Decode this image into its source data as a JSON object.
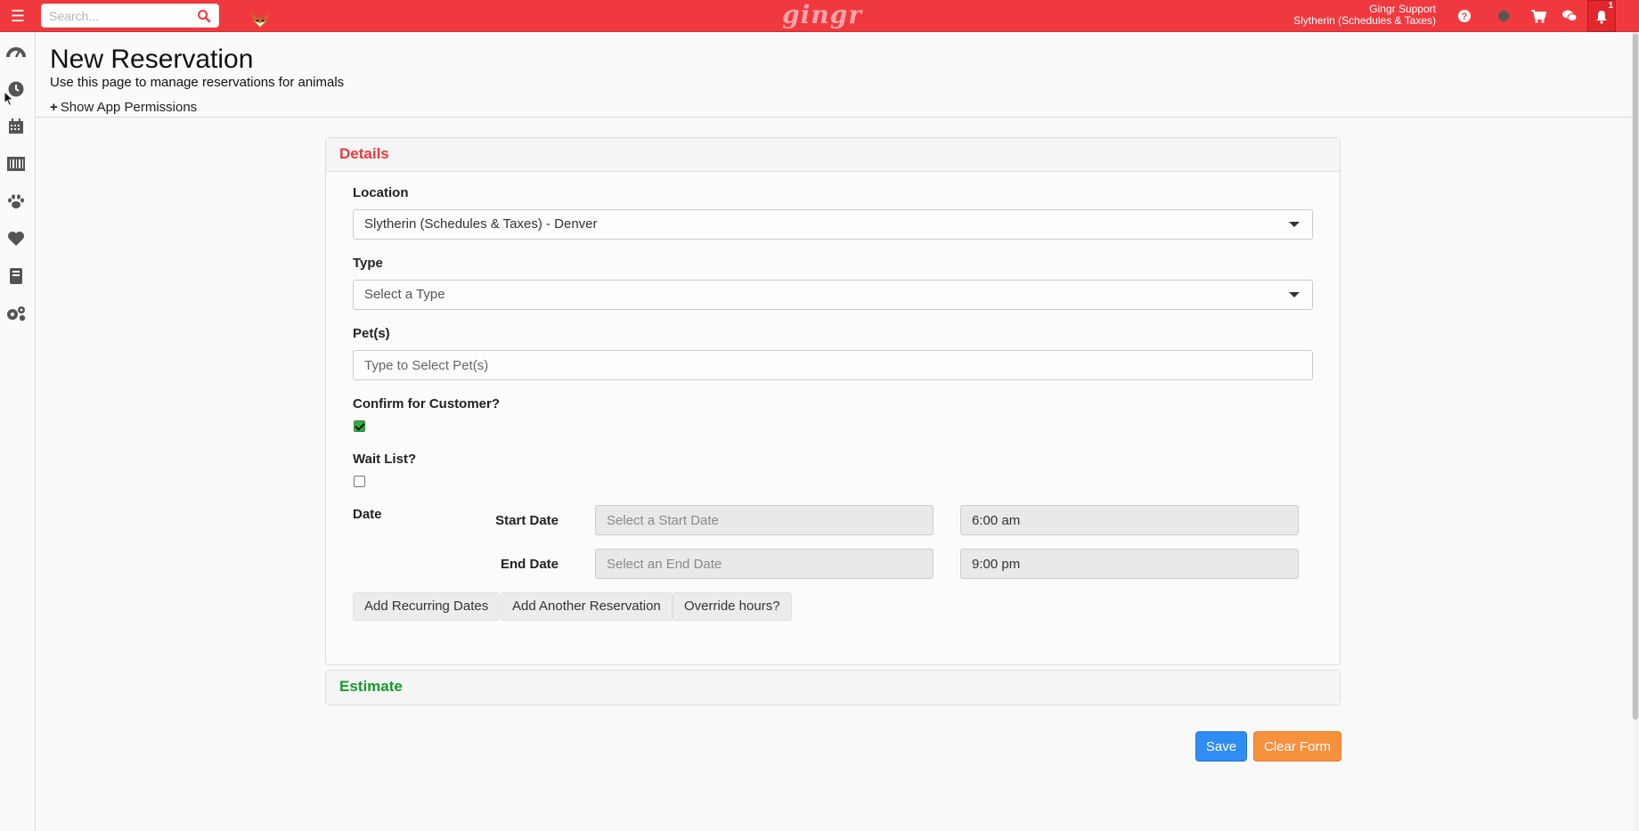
{
  "topbar": {
    "search_placeholder": "Search...",
    "brand": "gingr",
    "user_name": "Gingr Support",
    "user_location": "Slytherin (Schedules & Taxes)",
    "notification_count": "1",
    "accent_color": "#f0393f"
  },
  "sidebar": {
    "items": [
      {
        "icon": "dashboard-icon"
      },
      {
        "icon": "clock-icon"
      },
      {
        "icon": "calendar-icon"
      },
      {
        "icon": "barcode-icon"
      },
      {
        "icon": "paw-icon"
      },
      {
        "icon": "heart-icon"
      },
      {
        "icon": "book-icon"
      },
      {
        "icon": "gears-icon"
      }
    ]
  },
  "header": {
    "title": "New Reservation",
    "subtitle": "Use this page to manage reservations for animals",
    "permissions_link": "Show App Permissions"
  },
  "details": {
    "heading": "Details",
    "location_label": "Location",
    "location_value": "Slytherin (Schedules & Taxes) - Denver",
    "type_label": "Type",
    "type_value": "Select a Type",
    "pets_label": "Pet(s)",
    "pets_placeholder": "Type to Select Pet(s)",
    "confirm_label": "Confirm for Customer?",
    "confirm_checked": true,
    "waitlist_label": "Wait List?",
    "waitlist_checked": false,
    "date_label": "Date",
    "start_date_label": "Start Date",
    "start_date_placeholder": "Select a Start Date",
    "start_time": "6:00 am",
    "end_date_label": "End Date",
    "end_date_placeholder": "Select an End Date",
    "end_time": "9:00 pm",
    "btn_recurring": "Add Recurring Dates",
    "btn_another": "Add Another Reservation",
    "btn_override": "Override hours?"
  },
  "estimate": {
    "heading": "Estimate"
  },
  "actions": {
    "save": "Save",
    "clear": "Clear Form"
  }
}
